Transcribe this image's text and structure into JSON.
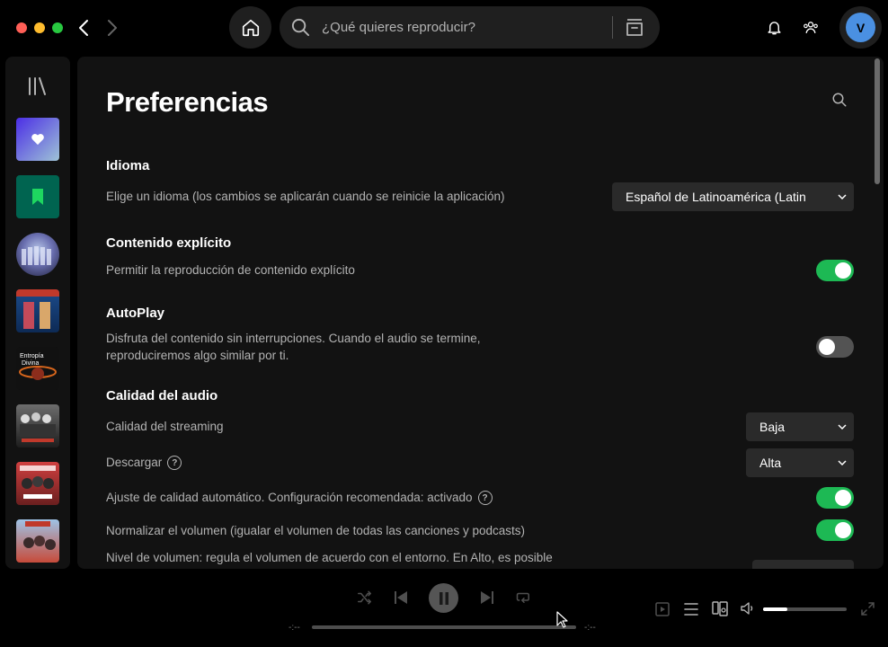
{
  "titlebar": {
    "traffic_colors": [
      "#ff5f57",
      "#febc2e",
      "#28c840"
    ],
    "search_placeholder": "¿Qué quieres reproducir?",
    "avatar_initial": "V",
    "avatar_color": "#4a90e2"
  },
  "page": {
    "title": "Preferencias"
  },
  "sections": {
    "language": {
      "heading": "Idioma",
      "description": "Elige un idioma (los cambios se aplicarán cuando se reinicie la aplicación)",
      "selected": "Español de Latinoamérica (Latin"
    },
    "explicit": {
      "heading": "Contenido explícito",
      "description": "Permitir la reproducción de contenido explícito",
      "enabled": true
    },
    "autoplay": {
      "heading": "AutoPlay",
      "description_line1": "Disfruta del contenido sin interrupciones. Cuando el audio se termine,",
      "description_line2": "reproduciremos algo similar por ti.",
      "enabled": false
    },
    "audio_quality": {
      "heading": "Calidad del audio",
      "streaming_label": "Calidad del streaming",
      "streaming_value": "Baja",
      "download_label": "Descargar",
      "download_value": "Alta",
      "auto_adjust_label": "Ajuste de calidad automático. Configuración recomendada: activado",
      "auto_adjust_enabled": true,
      "normalize_label": "Normalizar el volumen (igualar el volumen de todas las canciones y podcasts)",
      "normalize_enabled": true,
      "volume_level_label": "Nivel de volumen: regula el volumen de acuerdo con el entorno. En Alto, es posible"
    }
  },
  "player": {
    "elapsed": "-:--",
    "remaining": "-:--",
    "progress": 0,
    "volume": 0.29
  },
  "colors": {
    "accent": "#1db954",
    "panel": "#121212",
    "control": "#2a2a2a"
  },
  "sidebar_icons": [
    "library-icon",
    "liked-songs-icon",
    "saved-episodes-icon",
    "playlist-cover",
    "album-cover",
    "album-cover",
    "album-cover",
    "album-cover",
    "album-cover"
  ]
}
